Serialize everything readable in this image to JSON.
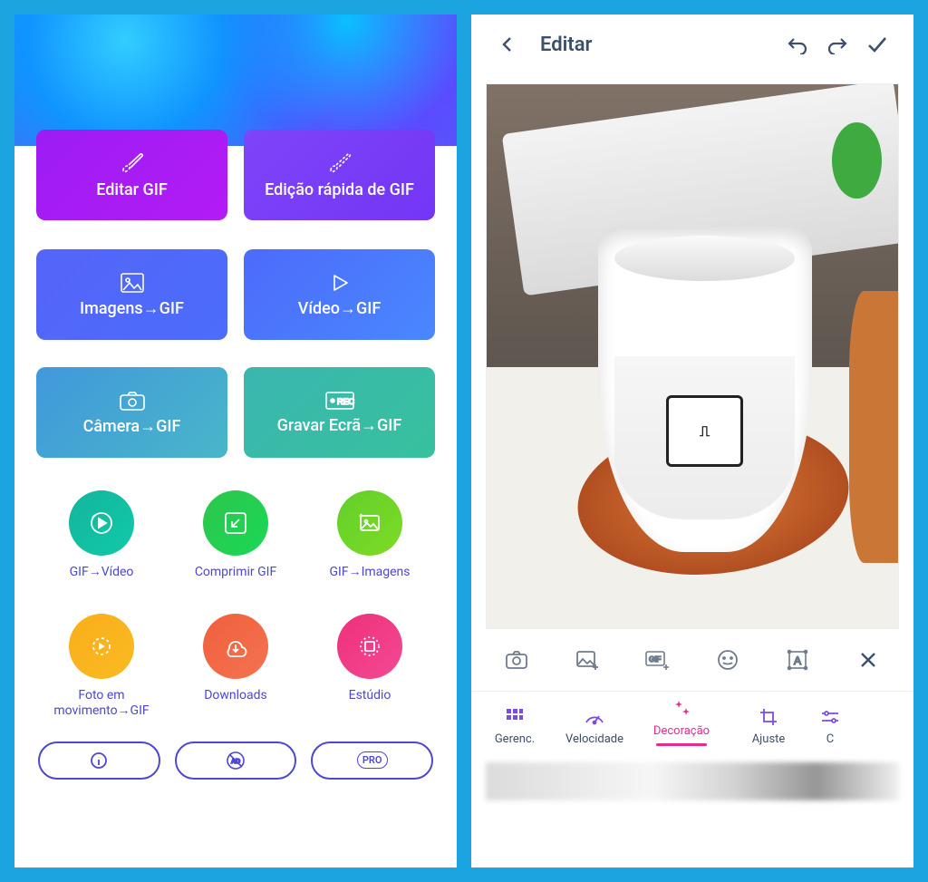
{
  "left": {
    "primary": {
      "edit_gif": "Editar GIF",
      "quick_edit": "Edição rápida de GIF",
      "images_gif": "Imagens→GIF",
      "video_gif": "Vídeo→GIF",
      "camera_gif": "Câmera→GIF",
      "record_gif": "Gravar Ecrã→GIF"
    },
    "circles": [
      {
        "label": "GIF→Vídeo",
        "color": "cgreen"
      },
      {
        "label": "Comprimir GIF",
        "color": "cgreen2"
      },
      {
        "label": "GIF→Imagens",
        "color": "cgreen3"
      },
      {
        "label": "Foto em movimento→GIF",
        "color": "corange"
      },
      {
        "label": "Downloads",
        "color": "cred"
      },
      {
        "label": "Estúdio",
        "color": "cpink"
      }
    ],
    "pills": {
      "info": "",
      "ads": "",
      "pro": "PRO"
    }
  },
  "right": {
    "title": "Editar",
    "tools": [
      "camera",
      "image",
      "gif",
      "emoji",
      "text",
      "close"
    ],
    "tabs": {
      "manage": "Gerenc.",
      "speed": "Velocidade",
      "decoration": "Decoração",
      "adjust": "Ajuste",
      "cut": "C"
    }
  }
}
